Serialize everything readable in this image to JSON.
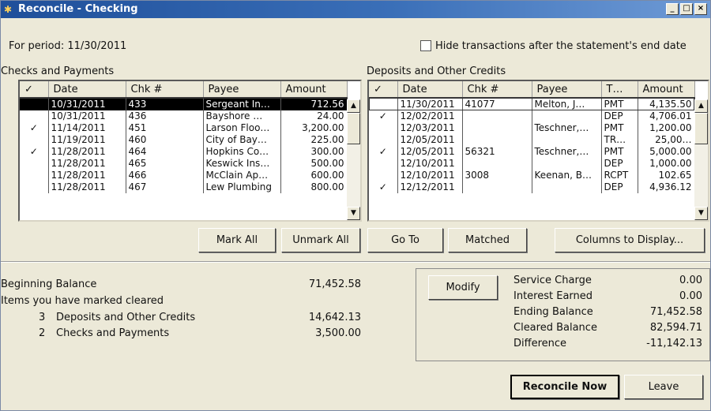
{
  "window": {
    "title": "Reconcile - Checking",
    "min_glyph": "_",
    "max_glyph": "□",
    "close_glyph": "×"
  },
  "period": {
    "label": "For period: 11/30/2011",
    "hide_label": "Hide transactions after the statement's end date",
    "hide_checked": false
  },
  "checks": {
    "title": "Checks and Payments",
    "columns": [
      "✓",
      "Date",
      "Chk #",
      "Payee",
      "Amount"
    ],
    "rows": [
      {
        "check": "",
        "date": "10/31/2011",
        "num": "433",
        "payee": "Sergeant In…",
        "amount": "712.56",
        "selected": true
      },
      {
        "check": "",
        "date": "10/31/2011",
        "num": "436",
        "payee": "Bayshore …",
        "amount": "24.00"
      },
      {
        "check": "✓",
        "date": "11/14/2011",
        "num": "451",
        "payee": "Larson Floo…",
        "amount": "3,200.00"
      },
      {
        "check": "",
        "date": "11/19/2011",
        "num": "460",
        "payee": "City of Bay…",
        "amount": "225.00"
      },
      {
        "check": "✓",
        "date": "11/28/2011",
        "num": "464",
        "payee": "Hopkins Co…",
        "amount": "300.00"
      },
      {
        "check": "",
        "date": "11/28/2011",
        "num": "465",
        "payee": "Keswick Ins…",
        "amount": "500.00"
      },
      {
        "check": "",
        "date": "11/28/2011",
        "num": "466",
        "payee": "McClain Ap…",
        "amount": "600.00"
      },
      {
        "check": "",
        "date": "11/28/2011",
        "num": "467",
        "payee": "Lew Plumbing",
        "amount": "800.00"
      }
    ]
  },
  "deposits": {
    "title": "Deposits and Other Credits",
    "columns": [
      "✓",
      "Date",
      "Chk #",
      "Payee",
      "T…",
      "Amount"
    ],
    "rows": [
      {
        "check": "",
        "date": "11/30/2011",
        "num": "41077",
        "payee": "Melton, J…",
        "type": "PMT",
        "amount": "4,135.50"
      },
      {
        "check": "✓",
        "date": "12/02/2011",
        "num": "",
        "payee": "",
        "type": "DEP",
        "amount": "4,706.01"
      },
      {
        "check": "",
        "date": "12/03/2011",
        "num": "",
        "payee": "Teschner,…",
        "type": "PMT",
        "amount": "1,200.00"
      },
      {
        "check": "",
        "date": "12/05/2011",
        "num": "",
        "payee": "",
        "type": "TR…",
        "amount": "25,00…"
      },
      {
        "check": "✓",
        "date": "12/05/2011",
        "num": "56321",
        "payee": "Teschner,…",
        "type": "PMT",
        "amount": "5,000.00"
      },
      {
        "check": "",
        "date": "12/10/2011",
        "num": "",
        "payee": "",
        "type": "DEP",
        "amount": "1,000.00"
      },
      {
        "check": "",
        "date": "12/10/2011",
        "num": "3008",
        "payee": "Keenan, B…",
        "type": "RCPT",
        "amount": "102.65"
      },
      {
        "check": "✓",
        "date": "12/12/2011",
        "num": "",
        "payee": "",
        "type": "DEP",
        "amount": "4,936.12"
      }
    ]
  },
  "buttons": {
    "mark_all": "Mark All",
    "unmark_all": "Unmark All",
    "go_to": "Go To",
    "matched": "Matched",
    "columns_to_display": "Columns to Display...",
    "modify": "Modify",
    "reconcile_now": "Reconcile Now",
    "leave": "Leave"
  },
  "summary": {
    "beginning_balance_label": "Beginning Balance",
    "beginning_balance": "71,452.58",
    "items_marked_label": "Items you have marked cleared",
    "deposits_count": "3",
    "deposits_label": "Deposits and Other Credits",
    "deposits_total": "14,642.13",
    "checks_count": "2",
    "checks_label": "Checks and Payments",
    "checks_total": "3,500.00"
  },
  "totals": {
    "service_charge_label": "Service Charge",
    "service_charge": "0.00",
    "interest_earned_label": "Interest Earned",
    "interest_earned": "0.00",
    "ending_balance_label": "Ending Balance",
    "ending_balance": "71,452.58",
    "cleared_balance_label": "Cleared Balance",
    "cleared_balance": "82,594.71",
    "difference_label": "Difference",
    "difference": "-11,142.13"
  }
}
